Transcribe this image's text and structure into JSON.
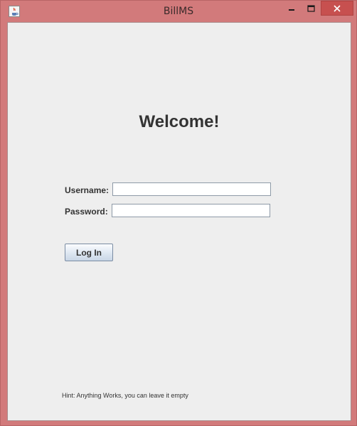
{
  "window": {
    "title": "BillMS",
    "icon": "java-icon",
    "controls": {
      "minimize_icon": "minimize-icon",
      "maximize_icon": "maximize-icon",
      "close_icon": "close-icon"
    },
    "frame_color": "#d27a7b",
    "close_color": "#c7504f"
  },
  "login": {
    "heading": "Welcome!",
    "username_label": "Username:",
    "username_value": "",
    "password_label": "Password:",
    "password_value": "",
    "submit_label": "Log In"
  },
  "footer": {
    "hint": "Hint: Anything Works, you can leave it empty"
  }
}
